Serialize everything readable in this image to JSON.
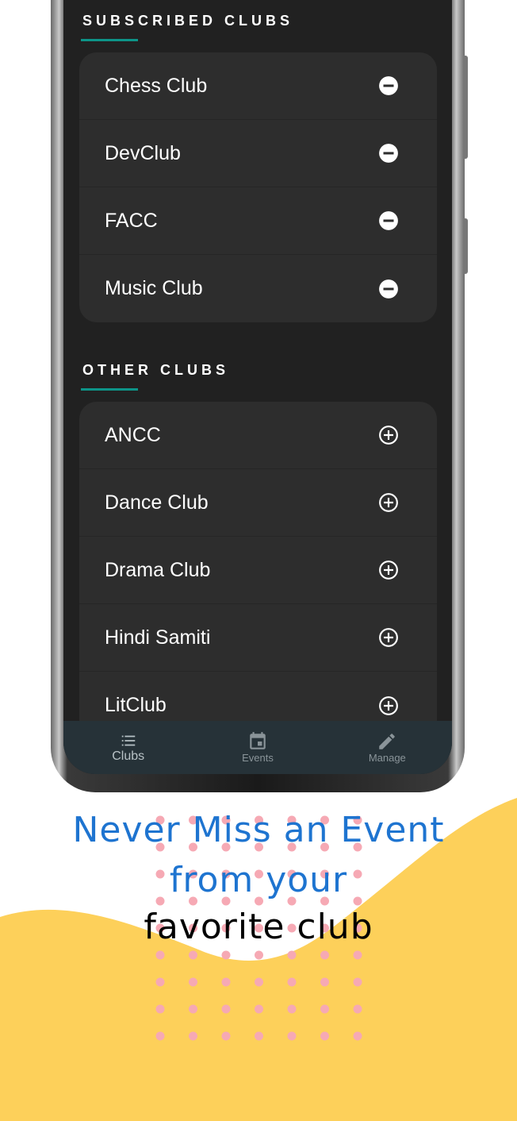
{
  "subscribed": {
    "title": "SUBSCRIBED CLUBS",
    "clubs": [
      "Chess Club",
      "DevClub",
      "FACC",
      "Music Club"
    ],
    "action_icon": "minus-circle-icon"
  },
  "other": {
    "title": "OTHER CLUBS",
    "clubs": [
      "ANCC",
      "Dance Club",
      "Drama Club",
      "Hindi Samiti",
      "LitClub"
    ],
    "action_icon": "plus-circle-outline-icon"
  },
  "nav": [
    {
      "label": "Clubs",
      "icon": "list-icon",
      "active": true
    },
    {
      "label": "Events",
      "icon": "calendar-icon"
    },
    {
      "label": "Manage",
      "icon": "pencil-icon"
    }
  ],
  "promo": {
    "line1": "Never Miss an Event",
    "line2": "from your",
    "line3": "favorite club"
  },
  "colors": {
    "accent": "#0d9488",
    "headline_blue": "#1e74d0",
    "wave": "#fdd05a",
    "dots": "#f6a9b4"
  }
}
